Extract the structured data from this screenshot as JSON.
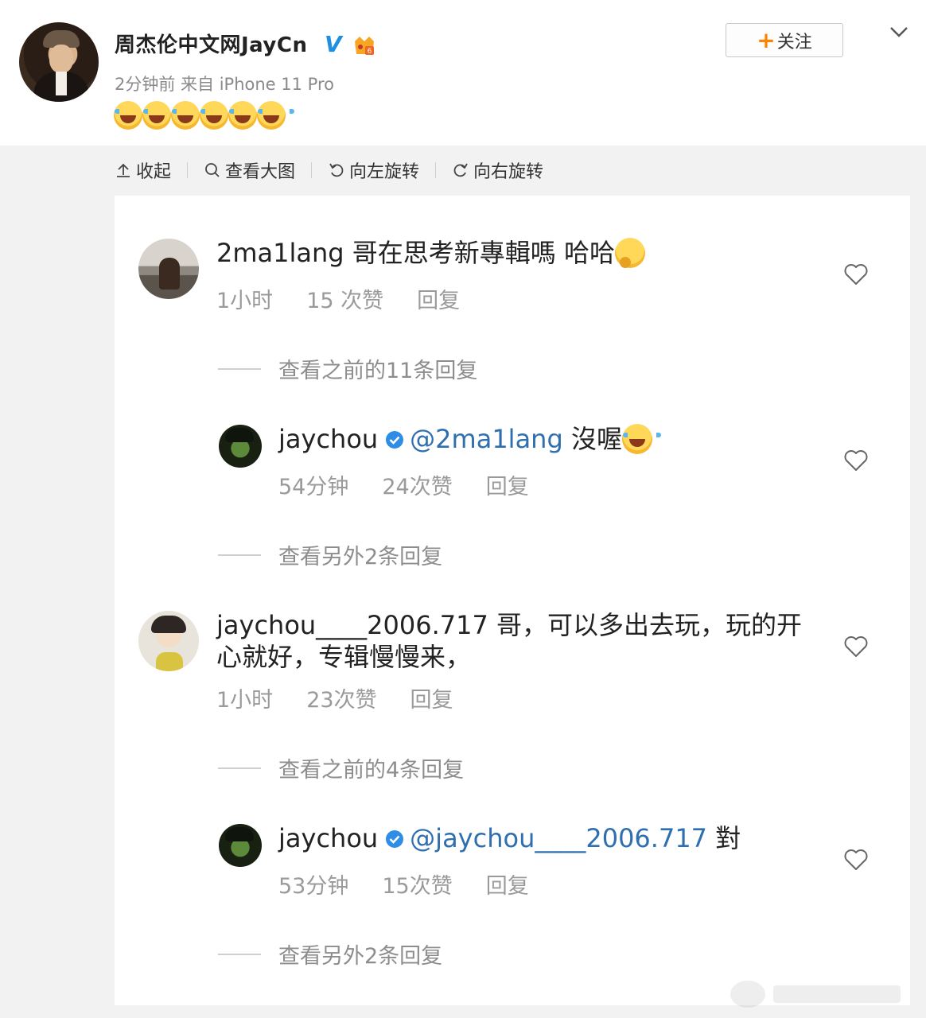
{
  "post": {
    "author": "周杰伦中文网JayCn",
    "meta": "2分钟前 来自 iPhone 11 Pro",
    "emoji_count": 6,
    "emoji_icon": "laugh-cry-emoji",
    "follow_label": "关注"
  },
  "toolbar": {
    "collapse": "收起",
    "view_large": "查看大图",
    "rotate_left": "向左旋转",
    "rotate_right": "向右旋转"
  },
  "comments": [
    {
      "username": "2ma1lang",
      "text": "哥在思考新專輯嗎 哈哈",
      "emoji": "thinking-face-emoji",
      "time": "1小时",
      "likes": "15 次赞",
      "reply": "回复",
      "more": "查看之前的11条回复"
    },
    {
      "username": "jaychou",
      "verified": true,
      "mention": "@2ma1lang",
      "text": "沒喔",
      "emoji": "laugh-cry-emoji",
      "time": "54分钟",
      "likes": "24次赞",
      "reply": "回复",
      "more": "查看另外2条回复"
    },
    {
      "username": "jaychou____2006.717",
      "text": "哥，可以多出去玩，玩的开心就好，专辑慢慢来，",
      "time": "1小时",
      "likes": "23次赞",
      "reply": "回复",
      "more": "查看之前的4条回复"
    },
    {
      "username": "jaychou",
      "verified": true,
      "mention": "@jaychou____2006.717",
      "text": "對",
      "time": "53分钟",
      "likes": "15次赞",
      "reply": "回复",
      "more": "查看另外2条回复"
    }
  ],
  "colors": {
    "verified_blue": "#1e8fe1",
    "mention_blue": "#2e6fb0",
    "follow_plus_orange": "#ff8200",
    "meta_gray": "#9a9a9a"
  }
}
